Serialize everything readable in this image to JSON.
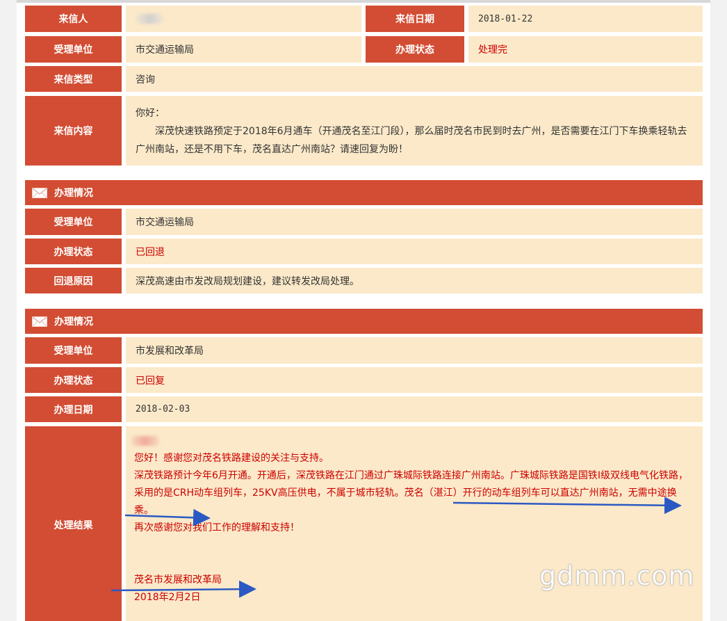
{
  "letter": {
    "sender_label": "来信人",
    "date_label": "来信日期",
    "date_value": "2018-01-22",
    "unit_label": "受理单位",
    "unit_value": "市交通运输局",
    "status_label": "办理状态",
    "status_value": "处理完",
    "type_label": "来信类型",
    "type_value": "咨询",
    "content_label": "来信内容",
    "content_greeting": "你好：",
    "content_body": "深茂快速铁路预定于2018年6月通车（开通茂名至江门段），那么届时茂名市民到时去广州，是否需要在江门下车换乘轻轨去广州南站，还是不用下车，茂名直达广州南站？请速回复为盼！"
  },
  "handling1": {
    "title": "办理情况",
    "unit_label": "受理单位",
    "unit_value": "市交通运输局",
    "status_label": "办理状态",
    "status_value": "已回退",
    "reason_label": "回退原因",
    "reason_value": "深茂高速由市发改局规划建设，建议转发改局处理。"
  },
  "handling2": {
    "title": "办理情况",
    "unit_label": "受理单位",
    "unit_value": "市发展和改革局",
    "status_label": "办理状态",
    "status_value": "已回复",
    "date_label": "办理日期",
    "date_value": "2018-02-03",
    "result_label": "处理结果",
    "result_lines": [
      "您好！感谢您对茂名铁路建设的关注与支持。",
      "深茂铁路预计今年6月开通。开通后，深茂铁路在江门通过广珠城际铁路连接广州南站。广珠城际铁路是国铁Ⅰ级双线电气化铁路，采用的是CRH动车组列车，25KV高压供电，不属于城市轻轨。茂名（湛江）开行的动车组列车可以直达广州南站，无需中途换乘。",
      "再次感谢您对我们工作的理解和支持！"
    ],
    "signature_org": "茂名市发展和改革局",
    "signature_date": "2018年2月2日"
  },
  "watermark": "gdmm.com",
  "colors": {
    "label_bg": "#d24d33",
    "value_bg": "#fbe9c9",
    "highlight": "#cc0000",
    "arrow": "#2b59c3"
  }
}
